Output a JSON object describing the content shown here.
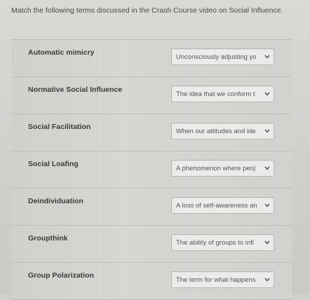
{
  "instructions": "Match the following terms discussed in the Crash Course video on Social Influence.",
  "rows": [
    {
      "term": "Automatic mimicry",
      "selected": "Unconsciously adjusting yo"
    },
    {
      "term": "Normative Social Influence",
      "selected": "The idea that we conform t"
    },
    {
      "term": "Social Facilitation",
      "selected": "When our attitudes and ide"
    },
    {
      "term": "Social Loafing",
      "selected": "A phenomenon where peo|"
    },
    {
      "term": "Deindividuation",
      "selected": "A loss of self-awareness an"
    },
    {
      "term": "Groupthink",
      "selected": "The ability of groups to infl"
    },
    {
      "term": "Group Polarization",
      "selected": "The term for what happens"
    }
  ],
  "icons": {
    "dropdown": "chevron-down-icon"
  }
}
